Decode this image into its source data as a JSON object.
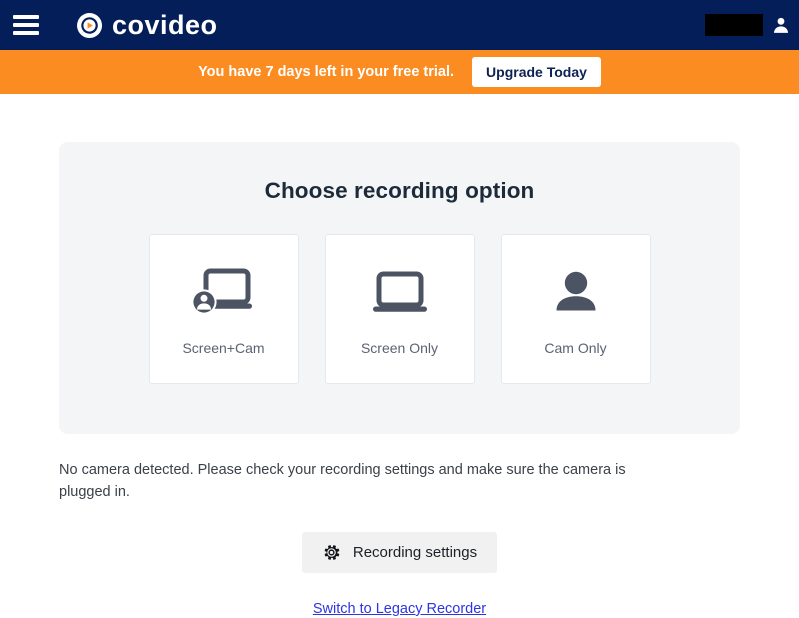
{
  "header": {
    "menu_icon": "hamburger-menu-icon",
    "logo_text": "covideo",
    "logo_icon": "covideo-play-circle-icon",
    "user_name_redacted": "",
    "avatar_icon": "user-avatar-icon"
  },
  "banner": {
    "message": "You have 7 days left in your free trial.",
    "upgrade_label": "Upgrade Today",
    "background_color": "#fb8c22"
  },
  "panel": {
    "title": "Choose recording option",
    "options": [
      {
        "label": "Screen+Cam",
        "icon": "laptop-with-person-icon"
      },
      {
        "label": "Screen Only",
        "icon": "laptop-icon"
      },
      {
        "label": "Cam Only",
        "icon": "person-icon"
      }
    ]
  },
  "notice": {
    "text": "No camera detected. Please check your recording settings and make sure the camera is plugged in."
  },
  "settings": {
    "label": "Recording settings",
    "icon": "gear-icon"
  },
  "legacy": {
    "label": "Switch to Legacy Recorder",
    "color": "#2d35e0"
  },
  "colors": {
    "header_navy": "#041e5a",
    "accent_orange": "#fb8c22",
    "panel_gray": "#f4f5f7",
    "icon_slate": "#4c5363"
  }
}
